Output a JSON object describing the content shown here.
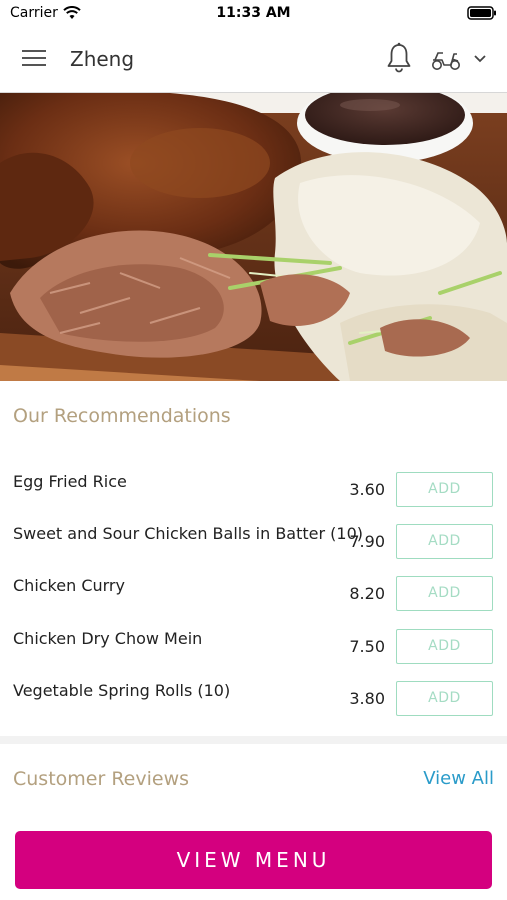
{
  "status_bar": {
    "carrier": "Carrier",
    "time": "11:33 AM",
    "icons": [
      "wifi-icon",
      "battery-icon"
    ]
  },
  "header": {
    "title": "Zheng",
    "icons": [
      "hamburger-menu-icon",
      "bell-icon",
      "delivery-scooter-icon",
      "chevron-down-icon"
    ]
  },
  "recommendations": {
    "title": "Our Recommendations",
    "add_label": "ADD",
    "items": [
      {
        "name": "Egg Fried Rice",
        "price": "3.60"
      },
      {
        "name": "Sweet and Sour Chicken Balls in Batter (10)",
        "price": "7.90"
      },
      {
        "name": "Chicken Curry",
        "price": "8.20"
      },
      {
        "name": "Chicken Dry Chow Mein",
        "price": "7.50"
      },
      {
        "name": "Vegetable Spring Rolls (10)",
        "price": "3.80"
      }
    ]
  },
  "reviews": {
    "title": "Customer Reviews",
    "view_all": "View All"
  },
  "footer": {
    "view_menu": "VIEW MENU"
  },
  "colors": {
    "section_title": "#b3a07f",
    "add_border": "#9fdcc0",
    "link": "#2a9bc9",
    "primary_button": "#d4007f"
  }
}
